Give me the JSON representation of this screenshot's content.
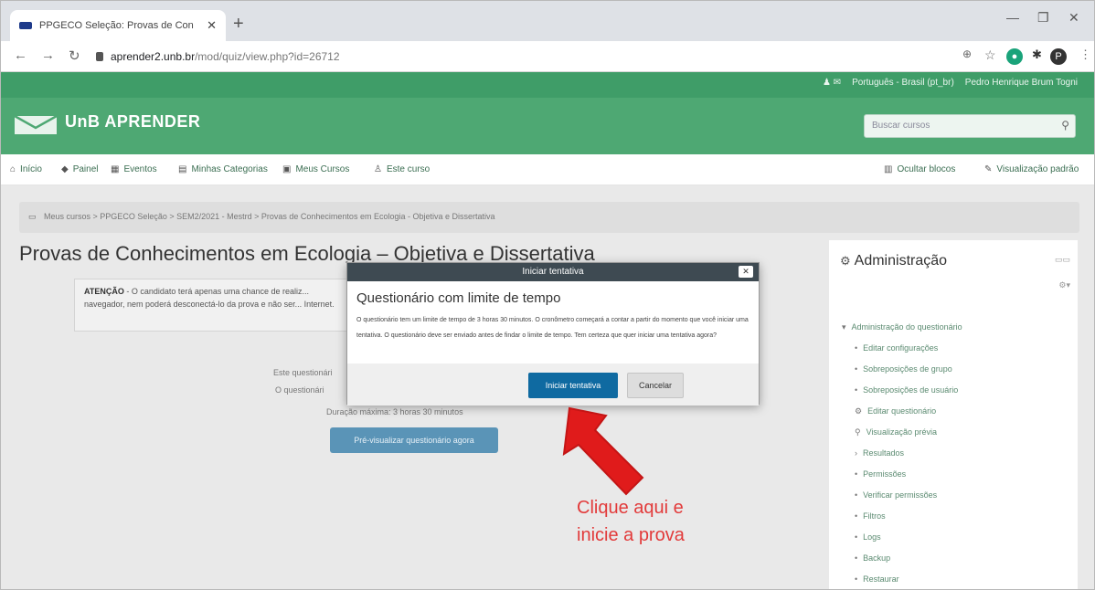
{
  "browser": {
    "tab_title": "PPGECO Seleção: Provas de Con",
    "url_domain": "aprender2.unb.br",
    "url_path": "/mod/quiz/view.php?id=26712"
  },
  "site": {
    "user_lang": "Português - Brasil (pt_br)",
    "user_name": "Pedro Henrique Brum Togni",
    "brand": "UnB APRENDER",
    "search_placeholder": "Buscar cursos"
  },
  "menu": {
    "home": "Início",
    "panel": "Painel",
    "events": "Eventos",
    "categories": "Minhas Categorias",
    "courses": "Meus Cursos",
    "this_course": "Este curso",
    "hide_blocks": "Ocultar blocos",
    "default_view": "Visualização padrão"
  },
  "breadcrumb": "Meus cursos > PPGECO Seleção > SEM2/2021 - Mestrd > Provas de Conhecimentos em Ecologia - Objetiva e Dissertativa",
  "page": {
    "title": "Provas de Conhecimentos em Ecologia – Objetiva e Dissertativa",
    "notice_label": "ATENÇÃO",
    "notice_text": "- O candidato terá apenas uma chance de realiz... navegador, nem poderá desconectá-lo da prova e não ser... Internet.",
    "info_1": "Este questionári",
    "info_2": "O questionári",
    "info_3": "Duração máxima: 3 horas 30 minutos",
    "preview_button": "Pré-visualizar questionário agora"
  },
  "admin": {
    "title": "Administração",
    "items": [
      "Administração do questionário",
      "Editar configurações",
      "Sobreposições de grupo",
      "Sobreposições de usuário",
      "Editar questionário",
      "Visualização prévia",
      "Resultados",
      "Permissões",
      "Verificar permissões",
      "Filtros",
      "Logs",
      "Backup",
      "Restaurar"
    ]
  },
  "modal": {
    "header": "Iniciar tentativa",
    "title": "Questionário com limite de tempo",
    "text": "O questionário tem um limite de tempo de 3 horas 30 minutos. O cronômetro começará a contar a partir do momento que você iniciar uma tentativa. O questionário deve ser enviado antes de findar o limite de tempo. Tem certeza que quer iniciar uma tentativa agora?",
    "start_button": "Iniciar tentativa",
    "cancel_button": "Cancelar"
  },
  "annotation": {
    "line1": "Clique aqui e",
    "line2": "inicie a prova",
    "color": "#e23a3a"
  },
  "colors": {
    "moodle_green": "#4ea873",
    "primary_button": "#0f6aa1"
  },
  "icons": [
    "back-icon",
    "forward-icon",
    "reload-icon",
    "lock-icon",
    "zoom-icon",
    "star-icon",
    "puzzle-icon",
    "close-icon",
    "search-icon",
    "gear-icon",
    "home-icon",
    "arrow-icon"
  ]
}
